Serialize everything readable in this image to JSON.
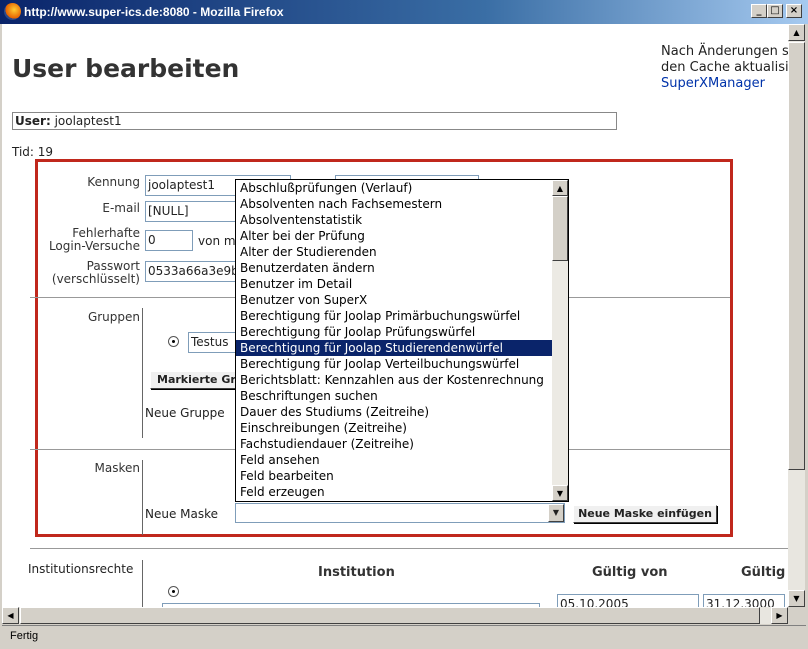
{
  "window": {
    "title": "http://www.super-ics.de:8080 - Mozilla Firefox"
  },
  "page": {
    "heading": "User bearbeiten",
    "note_line1": "Nach Änderungen s",
    "note_line2": "den Cache aktualisi",
    "note_link": "SuperXManager",
    "user_label": "User:",
    "user_value": "joolaptest1",
    "tid_label": "Tid:",
    "tid_value": "19"
  },
  "form": {
    "kennung_label": "Kennung",
    "kennung_value": "joolaptest1",
    "email_label": "E-mail",
    "email_value": "[NULL]",
    "failed_label_1": "Fehlerhafte",
    "failed_label_2": "Login-Versuche",
    "failed_value": "0",
    "failed_suffix": "von m",
    "pw_label_1": "Passwort",
    "pw_label_2": "(verschlüsselt)",
    "pw_value": "0533a66a3e9b"
  },
  "groups": {
    "label": "Gruppen",
    "selected": "Testus",
    "button": "Markierte Gru",
    "new_label": "Neue Gruppe"
  },
  "masks": {
    "label": "Masken",
    "new_label": "Neue Maske",
    "insert_button": "Neue Maske einfügen",
    "selected_index": 10,
    "options": [
      "Abschlußprüfungen (Verlauf)",
      "Absolventen nach Fachsemestern",
      "Absolventenstatistik",
      "Alter bei der Prüfung",
      "Alter der Studierenden",
      "Benutzerdaten ändern",
      "Benutzer im Detail",
      "Benutzer von SuperX",
      "Berechtigung für Joolap Primärbuchungswürfel",
      "Berechtigung für Joolap Prüfungswürfel",
      "Berechtigung für Joolap Studierendenwürfel",
      "Berechtigung für Joolap Verteilbuchungswürfel",
      "Berichtsblatt: Kennzahlen aus der Kostenrechnung",
      "Beschriftungen suchen",
      "Dauer des Studiums (Zeitreihe)",
      "Einschreibungen (Zeitreihe)",
      "Fachstudiendauer (Zeitreihe)",
      "Feld ansehen",
      "Feld bearbeiten",
      "Feld erzeugen"
    ]
  },
  "institution": {
    "label": "Institutionsrechte",
    "col_institution": "Institution",
    "col_from": "Gültig von",
    "col_to": "Gültig",
    "from_value": "05.10.2005",
    "to_value": "31.12.3000"
  },
  "status": {
    "text": "Fertig"
  },
  "colors": {
    "frame": "#c0281c",
    "selection": "#0a246a",
    "link": "#0033aa"
  }
}
